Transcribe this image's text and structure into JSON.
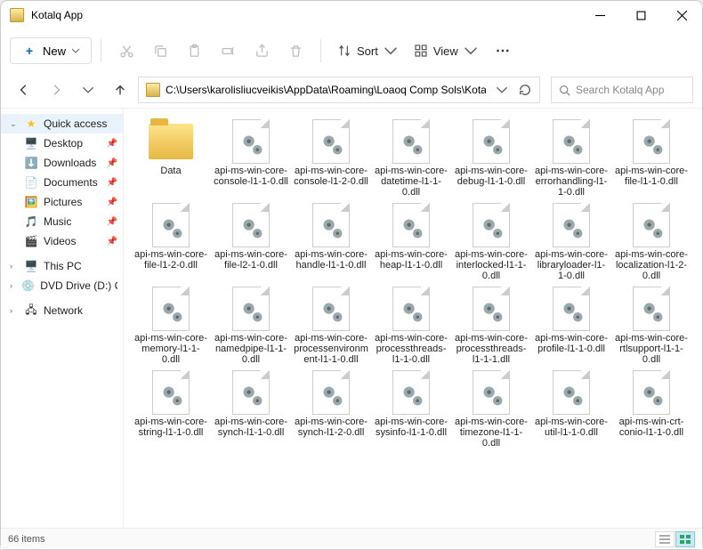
{
  "window": {
    "title": "Kotalq App"
  },
  "toolbar": {
    "new_label": "New",
    "sort_label": "Sort",
    "view_label": "View"
  },
  "nav": {
    "path": "C:\\Users\\karolisliucveikis\\AppData\\Roaming\\Loaoq Comp Sols\\Kotalq App",
    "search_placeholder": "Search Kotalq App"
  },
  "sidebar": {
    "quick": "Quick access",
    "items": [
      "Desktop",
      "Downloads",
      "Documents",
      "Pictures",
      "Music",
      "Videos"
    ],
    "pc": "This PC",
    "dvd": "DVD Drive (D:) CCCC",
    "net": "Network"
  },
  "files": [
    "Data",
    "api-ms-win-core-console-l1-1-0.dll",
    "api-ms-win-core-console-l1-2-0.dll",
    "api-ms-win-core-datetime-l1-1-0.dll",
    "api-ms-win-core-debug-l1-1-0.dll",
    "api-ms-win-core-errorhandling-l1-1-0.dll",
    "api-ms-win-core-file-l1-1-0.dll",
    "api-ms-win-core-file-l1-2-0.dll",
    "api-ms-win-core-file-l2-1-0.dll",
    "api-ms-win-core-handle-l1-1-0.dll",
    "api-ms-win-core-heap-l1-1-0.dll",
    "api-ms-win-core-interlocked-l1-1-0.dll",
    "api-ms-win-core-libraryloader-l1-1-0.dll",
    "api-ms-win-core-localization-l1-2-0.dll",
    "api-ms-win-core-memory-l1-1-0.dll",
    "api-ms-win-core-namedpipe-l1-1-0.dll",
    "api-ms-win-core-processenvironment-l1-1-0.dll",
    "api-ms-win-core-processthreads-l1-1-0.dll",
    "api-ms-win-core-processthreads-l1-1-1.dll",
    "api-ms-win-core-profile-l1-1-0.dll",
    "api-ms-win-core-rtlsupport-l1-1-0.dll",
    "api-ms-win-core-string-l1-1-0.dll",
    "api-ms-win-core-synch-l1-1-0.dll",
    "api-ms-win-core-synch-l1-2-0.dll",
    "api-ms-win-core-sysinfo-l1-1-0.dll",
    "api-ms-win-core-timezone-l1-1-0.dll",
    "api-ms-win-core-util-l1-1-0.dll",
    "api-ms-win-crt-conio-l1-1-0.dll"
  ],
  "status": {
    "count": "66 items"
  }
}
